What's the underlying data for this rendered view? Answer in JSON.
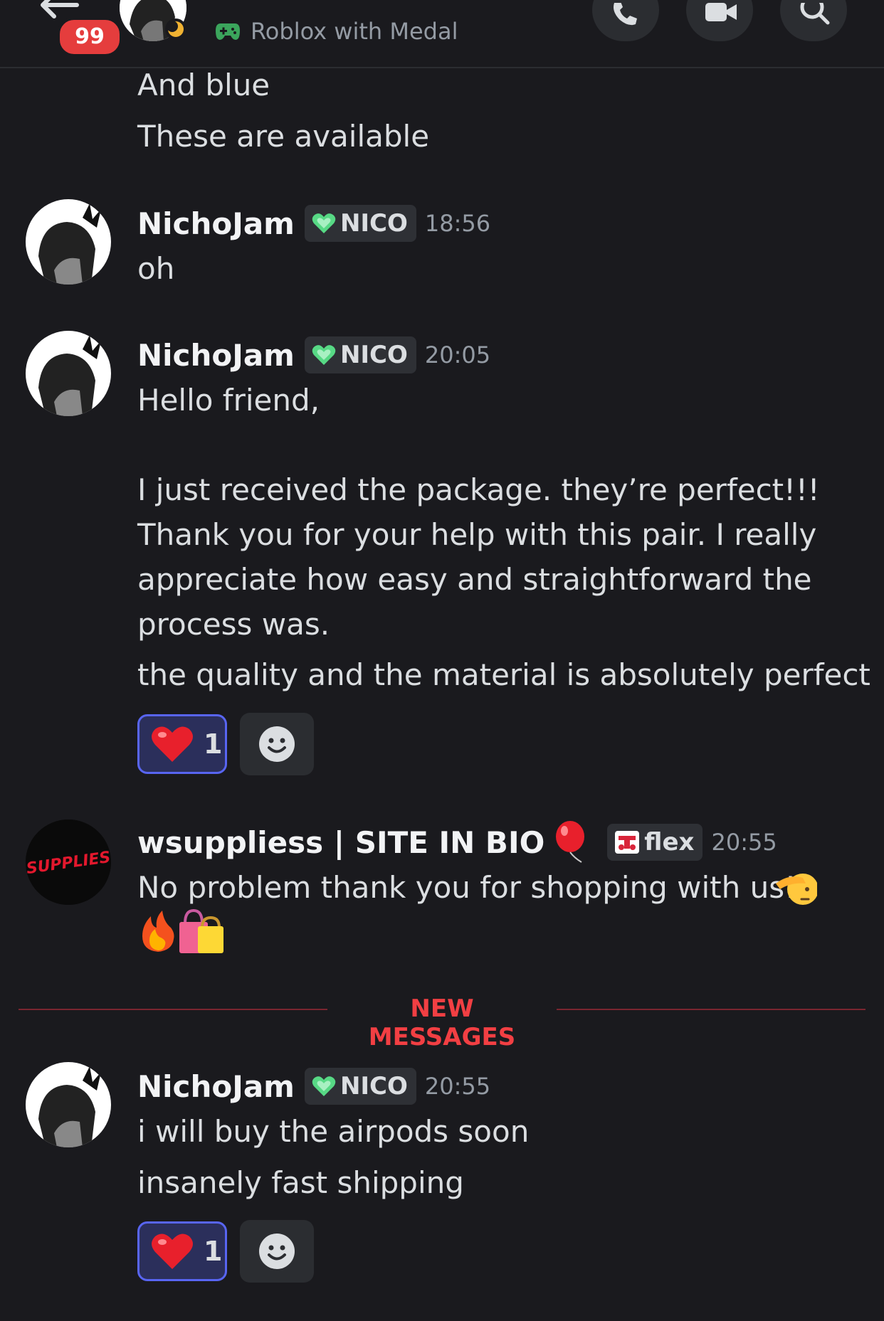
{
  "header": {
    "unread_count": "99",
    "activity": "Roblox with Medal"
  },
  "messages": [
    {
      "lines": [
        "And blue",
        "These are available"
      ]
    },
    {
      "author": "NichoJam",
      "tag": "NICO",
      "time": "18:56",
      "lines": [
        "oh"
      ]
    },
    {
      "author": "NichoJam",
      "tag": "NICO",
      "time": "20:05",
      "lines": [
        "Hello friend,",
        "I just received the package.  they’re perfect!!!",
        "Thank you for your help with this pair. I really",
        "appreciate how easy and straightforward the",
        "process was.",
        "the quality and the material is absolutely perfect"
      ],
      "reaction": {
        "emoji": "heart",
        "count": "1"
      }
    },
    {
      "author": "wsuppliess | SITE IN BIO",
      "tag": "flex",
      "time": "20:55",
      "lines": [
        "No problem thank you for shopping with us!"
      ],
      "emojis": [
        "balloon",
        "salute",
        "fire",
        "shopping-bags"
      ],
      "avatar_text": "SUPPLIES"
    },
    {
      "author": "NichoJam",
      "tag": "NICO",
      "time": "20:55",
      "lines": [
        "i will buy the airpods soon",
        "insanely fast shipping"
      ],
      "reaction": {
        "emoji": "heart",
        "count": "1"
      }
    }
  ],
  "divider": {
    "label": "NEW MESSAGES"
  },
  "colors": {
    "background": "#1a1a1e",
    "tag_heart": "#57d985",
    "new_messages": "#f23f43",
    "reaction_border": "#5865f2"
  }
}
